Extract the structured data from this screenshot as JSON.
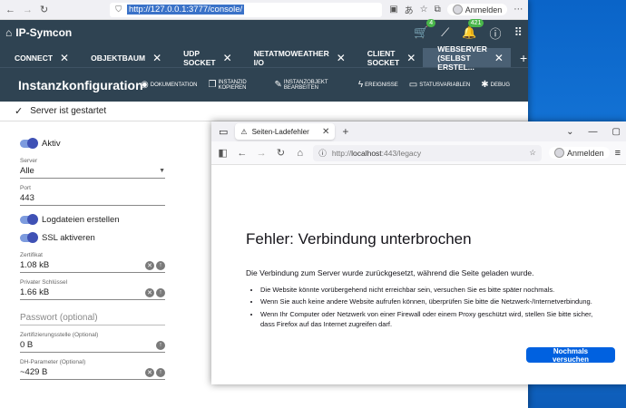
{
  "bg_browser": {
    "url": "http://127.0.0.1:3777/console/",
    "login_label": "Anmelden"
  },
  "app": {
    "name": "IP-Symcon",
    "badge_cart": "4",
    "badge_notifications": "421"
  },
  "tabs": [
    {
      "label": "CONNECT"
    },
    {
      "label": "OBJEKTBAUM"
    },
    {
      "label": "UDP SOCKET"
    },
    {
      "label": "NETATMOWEATHER I/O"
    },
    {
      "label": "CLIENT SOCKET"
    },
    {
      "label": "WEBSERVER (SELBST ERSTEL..."
    }
  ],
  "config": {
    "title": "Instanzkonfiguration",
    "actions": {
      "docs": "DOKUMENTATION",
      "copy_id": "INSTANZID KOPIEREN",
      "edit": "INSTANZOBJEKT BEARBEITEN",
      "events": "EREIGNISSE",
      "statusvars": "STATUSVARIABLEN",
      "debug": "DEBUG"
    }
  },
  "status": {
    "text": "Server ist gestartet"
  },
  "form": {
    "active_label": "Aktiv",
    "server_label": "Server",
    "server_value": "Alle",
    "port_label": "Port",
    "port_value": "443",
    "logfiles_label": "Logdateien erstellen",
    "ssl_label": "SSL aktiveren",
    "cert_label": "Zertifikat",
    "cert_value": "1.08 kB",
    "privkey_label": "Privater Schlüssel",
    "privkey_value": "1.66 kB",
    "password_placeholder": "Passwort (optional)",
    "ca_label": "Zertifizierungsstelle (Optional)",
    "ca_value": "0 B",
    "dh_label": "DH-Parameter (Optional)",
    "dh_value": "~429 B"
  },
  "fg_browser": {
    "tab_title": "Seiten-Ladefehler",
    "url_prefix": "http://",
    "url_host": "localhost",
    "url_rest": ":443/legacy",
    "login_label": "Anmelden"
  },
  "error": {
    "title": "Fehler: Verbindung unterbrochen",
    "description": "Die Verbindung zum Server wurde zurückgesetzt, während die Seite geladen wurde.",
    "bullets": [
      "Die Website könnte vorübergehend nicht erreichbar sein, versuchen Sie es bitte später nochmals.",
      "Wenn Sie auch keine andere Website aufrufen können, überprüfen Sie bitte die Netzwerk-/Internetverbindung.",
      "Wenn Ihr Computer oder Netzwerk von einer Firewall oder einem Proxy geschützt wird, stellen Sie bitte sicher, dass Firefox auf das Internet zugreifen darf."
    ],
    "retry_label": "Nochmals versuchen"
  }
}
